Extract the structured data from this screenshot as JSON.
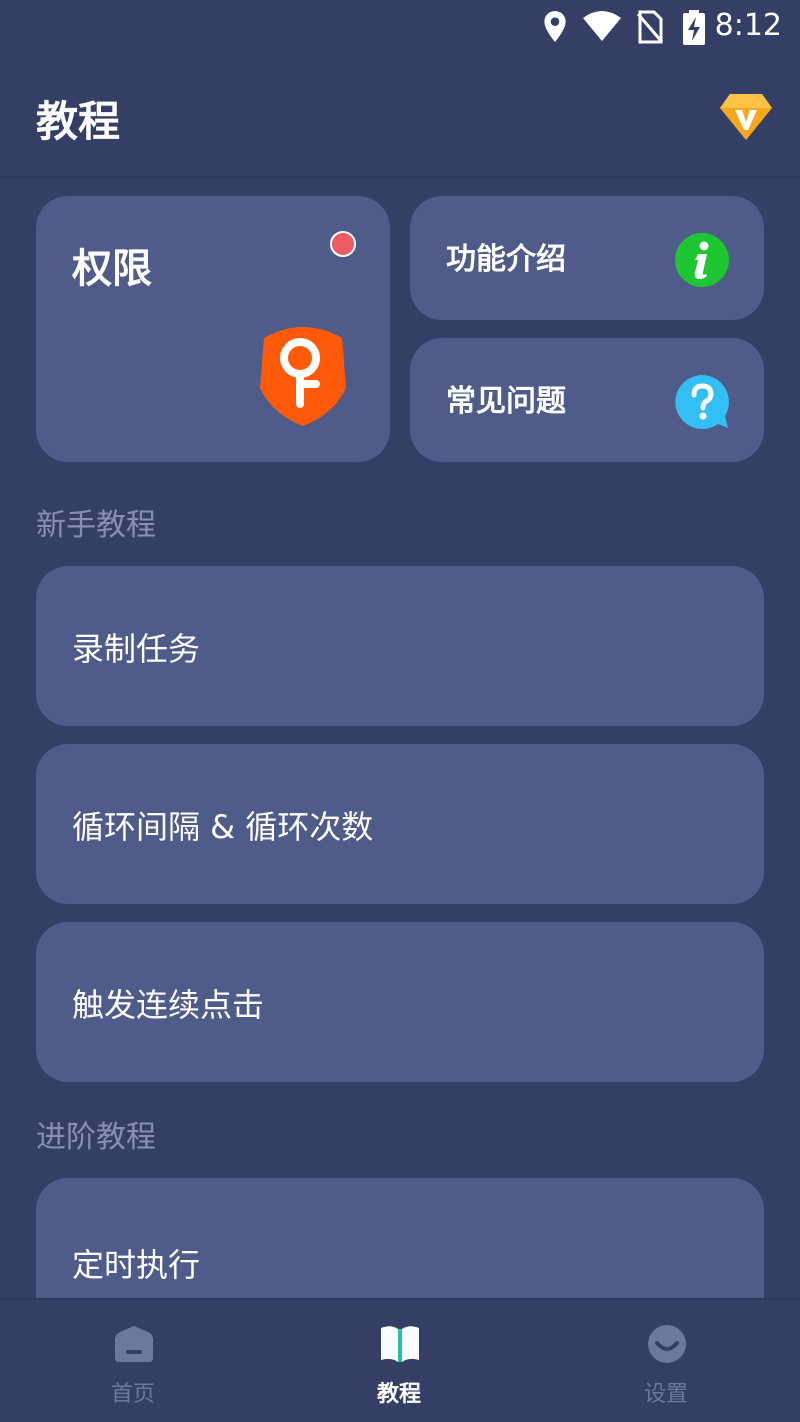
{
  "status_bar": {
    "time": "8:12",
    "icons": [
      "location-icon",
      "wifi-icon",
      "no-sim-icon",
      "battery-charging-icon"
    ]
  },
  "header": {
    "title": "教程",
    "vip_icon": "vip-diamond-icon"
  },
  "top_cards": {
    "permissions": {
      "label": "权限",
      "icon": "key-shield-icon",
      "badge_color": "#ef5b63"
    },
    "intro": {
      "label": "功能介绍",
      "icon": "info-icon",
      "icon_color": "#1ec631"
    },
    "faq": {
      "label": "常见问题",
      "icon": "question-bubble-icon",
      "icon_color": "#34bff4"
    }
  },
  "sections": [
    {
      "title": "新手教程",
      "items": [
        "录制任务",
        "循环间隔 & 循环次数",
        "触发连续点击"
      ]
    },
    {
      "title": "进阶教程",
      "items": [
        "定时执行"
      ]
    }
  ],
  "bottom_nav": {
    "items": [
      {
        "label": "首页",
        "icon": "home-icon",
        "active": false
      },
      {
        "label": "教程",
        "icon": "book-icon",
        "active": true
      },
      {
        "label": "设置",
        "icon": "smiley-settings-icon",
        "active": false
      }
    ]
  },
  "colors": {
    "background": "#353f66",
    "card": "#4f5b88",
    "section_text": "#8790b2",
    "key_orange": "#ff5a0a",
    "vip_gold": "#f7a81b"
  }
}
